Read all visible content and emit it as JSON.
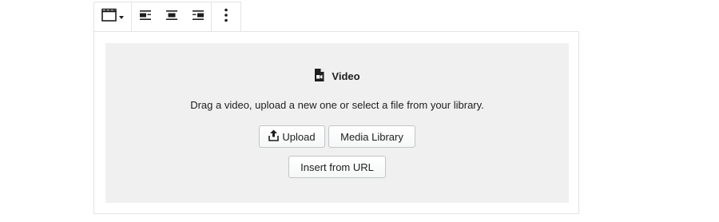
{
  "toolbar": {
    "block_icon": "video-clapperboard-icon",
    "align_options": [
      "align-left-icon",
      "align-center-icon",
      "align-right-icon"
    ],
    "more_icon": "vertical-ellipsis-icon"
  },
  "placeholder": {
    "icon": "video-file-icon",
    "label": "Video",
    "instructions": "Drag a video, upload a new one or select a file from your library.",
    "upload_label": "Upload",
    "media_library_label": "Media Library",
    "insert_url_label": "Insert from URL"
  }
}
